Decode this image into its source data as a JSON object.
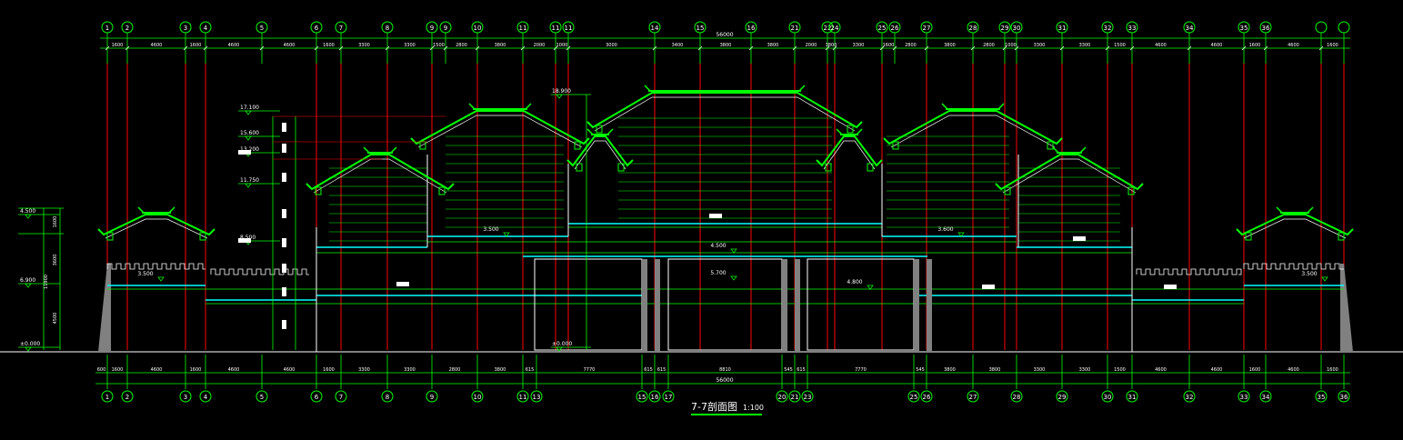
{
  "drawing": {
    "title": "7-7剖面图",
    "scale": "1:100"
  },
  "colors": {
    "background": "#000000",
    "grid": "#00ff00",
    "column": "#ff0000",
    "beam": "#00ffff",
    "roof": "#00ff00",
    "white": "#ffffff",
    "ground": "#ffffff",
    "wall": "#808080",
    "title_underline": "#00ff00"
  },
  "axes_top": [
    "1",
    "2",
    "3",
    "4",
    "5",
    "6",
    "7",
    "8",
    "9",
    "9a",
    "10",
    "11",
    "11a",
    "11b",
    "14",
    "15",
    "16",
    "21",
    "22",
    "24",
    "25",
    "26",
    "27",
    "28",
    "29",
    "30",
    "31",
    "32",
    "33",
    "34",
    "35",
    "36"
  ],
  "axes_bottom": [
    "1",
    "2",
    "3",
    "4",
    "5",
    "6",
    "7",
    "8",
    "9",
    "10",
    "11",
    "13",
    "15",
    "16",
    "17",
    "20",
    "21",
    "23",
    "25",
    "26",
    "27",
    "28",
    "29",
    "30",
    "31",
    "32",
    "33",
    "34",
    "35",
    "36"
  ],
  "overall_dimension": "56000",
  "dims_top": [
    "1600",
    "4600",
    "1600",
    "4600",
    "4600",
    "1600",
    "3300",
    "3300",
    "1500",
    "2800",
    "3800",
    "2000",
    "1000",
    "3000",
    "3400",
    "3800",
    "3800",
    "2000",
    "3800",
    "3300",
    "1600",
    "2800",
    "3800",
    "2800",
    "1000",
    "3300",
    "3300",
    "1500",
    "4600",
    "4600",
    "1600",
    "4600",
    "1600"
  ],
  "dims_bottom": [
    "600",
    "1600",
    "4600",
    "1600",
    "4600",
    "4600",
    "1600",
    "3300",
    "3300",
    "2800",
    "3800",
    "615",
    "7770",
    "615",
    "615",
    "8810",
    "545",
    "615",
    "7770",
    "545",
    "3800",
    "3800",
    "3300",
    "3300",
    "1500",
    "4600",
    "4600",
    "1600",
    "4600",
    "1600"
  ],
  "elevations_left": [
    {
      "label": "17.100"
    },
    {
      "label": "15.600"
    },
    {
      "label": "13.200"
    },
    {
      "label": "11.750"
    },
    {
      "label": "8.500"
    },
    {
      "label": "6.900"
    },
    {
      "label": "4.500"
    },
    {
      "label": "±0.000"
    }
  ],
  "elevations_center": [
    {
      "label": "18.900"
    },
    {
      "label": "±0.000"
    }
  ],
  "floor_labels": [
    "3.500",
    "3.500",
    "4.500",
    "5.700",
    "4.800",
    "3.600",
    "3.500"
  ],
  "dim_left_vertical": [
    "1600",
    "3600",
    "11900",
    "4500"
  ]
}
